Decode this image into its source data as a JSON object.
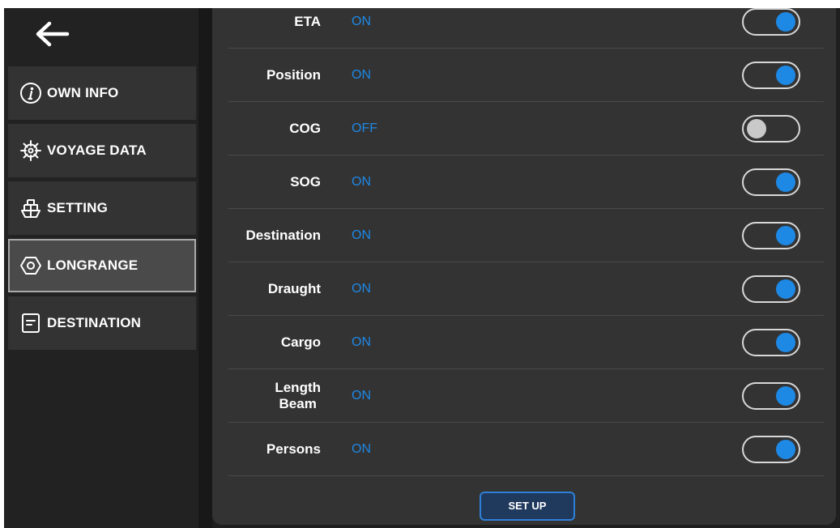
{
  "sidebar": {
    "items": [
      {
        "label": "OWN INFO",
        "icon": "info-icon"
      },
      {
        "label": "VOYAGE DATA",
        "icon": "ship-wheel-icon"
      },
      {
        "label": "SETTING",
        "icon": "ship-icon"
      },
      {
        "label": "LONGRANGE",
        "icon": "longrange-icon",
        "active": true
      },
      {
        "label": "DESTINATION",
        "icon": "document-icon"
      }
    ]
  },
  "settings": {
    "rows": [
      {
        "label": "ETA",
        "state": "ON"
      },
      {
        "label": "Position",
        "state": "ON"
      },
      {
        "label": "COG",
        "state": "OFF"
      },
      {
        "label": "SOG",
        "state": "ON"
      },
      {
        "label": "Destination",
        "state": "ON"
      },
      {
        "label": "Draught",
        "state": "ON"
      },
      {
        "label": "Cargo",
        "state": "ON"
      },
      {
        "label": "Length\nBeam",
        "state": "ON"
      },
      {
        "label": "Persons",
        "state": "ON"
      }
    ],
    "setup_label": "SET UP"
  },
  "colors": {
    "accent": "#1e88e5",
    "panel": "#333333",
    "background": "#1f1f1f"
  }
}
